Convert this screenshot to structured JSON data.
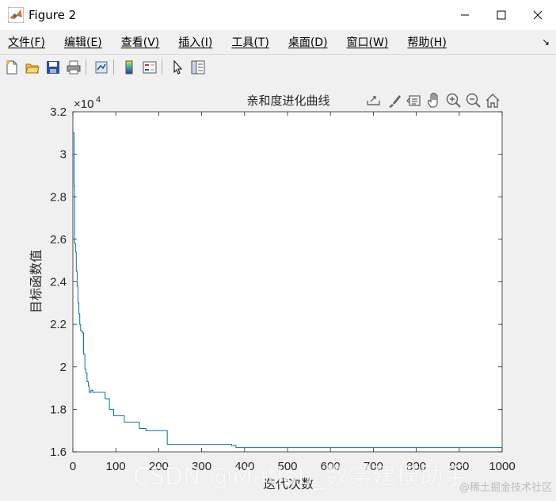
{
  "window": {
    "title": "Figure 2",
    "icon": "matlab-icon",
    "controls": [
      "minimize-icon",
      "maximize-icon",
      "close-icon"
    ]
  },
  "menu": {
    "items": [
      "文件(F)",
      "编辑(E)",
      "查看(V)",
      "插入(I)",
      "工具(T)",
      "桌面(D)",
      "窗口(W)",
      "帮助(H)"
    ],
    "dock_icon": "dock-arrow-icon"
  },
  "toolbar": {
    "icons": [
      "new-figure-icon",
      "open-file-icon",
      "save-icon",
      "print-icon",
      "link-plot-icon",
      "colorbar-icon",
      "legend-icon",
      "pointer-icon",
      "property-inspector-icon"
    ]
  },
  "axes_toolbar": {
    "icons": [
      "export-icon",
      "brush-icon",
      "data-tips-icon",
      "pan-icon",
      "zoom-in-icon",
      "zoom-out-icon",
      "home-icon"
    ]
  },
  "colors": {
    "line": "#0072bd",
    "axes_bg": "#ffffff",
    "figure_bg": "#f0f0f0"
  },
  "watermark": {
    "text": "CSDN @Matlab_数学建模助手",
    "text2": "@稀土掘金技术社区"
  },
  "chart_data": {
    "type": "line",
    "title": "亲和度进化曲线",
    "xlabel": "迭代次数",
    "ylabel": "目标函数值",
    "exponent": "×10",
    "exponent_power": "4",
    "xlim": [
      0,
      1000
    ],
    "ylim": [
      16000,
      32000
    ],
    "xticks": [
      0,
      100,
      200,
      300,
      400,
      500,
      600,
      700,
      800,
      900,
      1000
    ],
    "xtick_labels": [
      "0",
      "100",
      "200",
      "300",
      "400",
      "500",
      "600",
      "700",
      "800",
      "900",
      "1000"
    ],
    "yticks": [
      16000,
      18000,
      20000,
      22000,
      24000,
      26000,
      28000,
      30000,
      32000
    ],
    "ytick_labels": [
      "1.6",
      "1.8",
      "2",
      "2.2",
      "2.4",
      "2.6",
      "2.8",
      "3",
      "3.2"
    ],
    "grid": false,
    "series": [
      {
        "x": [
          1,
          3,
          4,
          6,
          8,
          10,
          12,
          14,
          16,
          18,
          20,
          22,
          25,
          28,
          30,
          33,
          36,
          38,
          42,
          46,
          55,
          65,
          75,
          85,
          95,
          105,
          120,
          130,
          140,
          155,
          160,
          170,
          215,
          220,
          300,
          370,
          380,
          400,
          500,
          600,
          700,
          800,
          900,
          1000
        ],
        "y": [
          31000,
          28500,
          25800,
          25400,
          24500,
          23800,
          23000,
          22500,
          22000,
          21700,
          21700,
          21600,
          20600,
          19900,
          19700,
          19300,
          19100,
          18800,
          18900,
          18800,
          18800,
          18800,
          18500,
          18000,
          17700,
          17700,
          17400,
          17400,
          17400,
          17100,
          17100,
          17000,
          17000,
          16350,
          16350,
          16300,
          16200,
          16200,
          16200,
          16200,
          16200,
          16200,
          16200,
          16200
        ]
      }
    ]
  }
}
